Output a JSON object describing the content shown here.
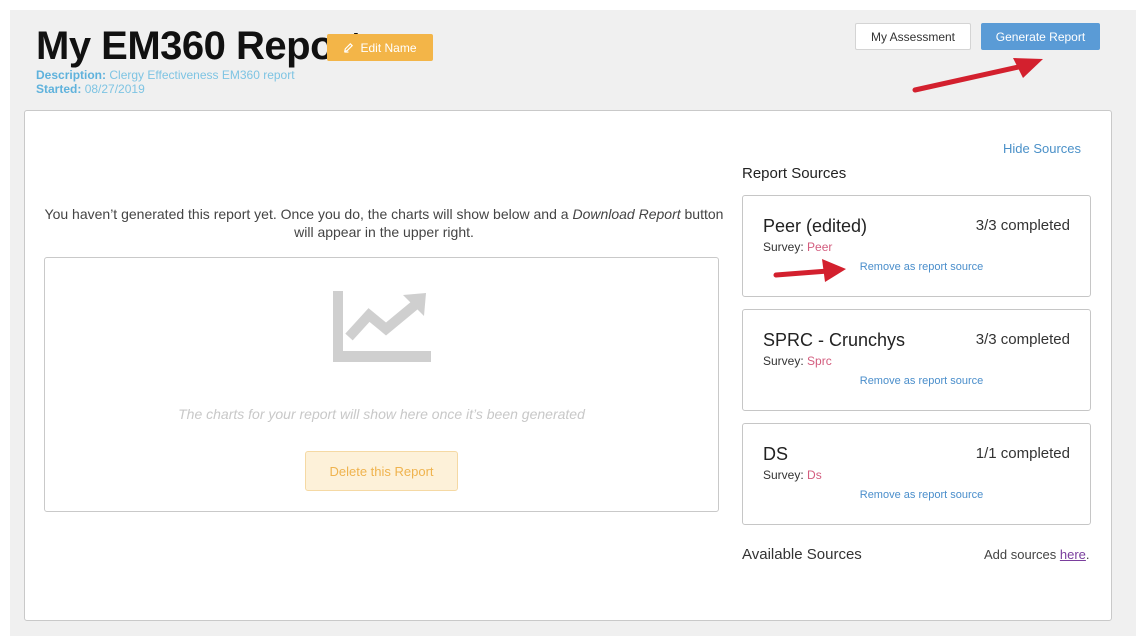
{
  "header": {
    "title": "My EM360 Report",
    "edit_label": "Edit Name",
    "description_label": "Description:",
    "description": "Clergy Effectiveness EM360 report",
    "started_label": "Started:",
    "started": "08/27/2019"
  },
  "toolbar": {
    "assessment_label": "My Assessment",
    "generate_label": "Generate Report"
  },
  "main": {
    "hide_sources": "Hide Sources",
    "notice_part1": "You haven’t generated this report yet. Once you do, the charts will show below and a ",
    "notice_em": "Download Report",
    "notice_part2": " button will appear in the upper right.",
    "chart_placeholder": "The charts for your report will show here once it’s been generated",
    "delete_label": "Delete this Report"
  },
  "sources": {
    "title": "Report Sources",
    "cards": [
      {
        "name": "Peer (edited)",
        "count": "3/3 completed",
        "survey_label": "Survey:",
        "survey": "Peer",
        "remove": "Remove as report source"
      },
      {
        "name": "SPRC - Crunchys",
        "count": "3/3 completed",
        "survey_label": "Survey:",
        "survey": "Sprc",
        "remove": "Remove as report source"
      },
      {
        "name": "DS",
        "count": "1/1 completed",
        "survey_label": "Survey:",
        "survey": "Ds",
        "remove": "Remove as report source"
      }
    ],
    "available_label": "Available Sources",
    "add_prefix": "Add sources ",
    "add_link": "here",
    "add_suffix": "."
  },
  "colors": {
    "edit_button": "#f3b548",
    "generate_button": "#5a9bd6",
    "annotation_arrow": "#d3202e"
  }
}
